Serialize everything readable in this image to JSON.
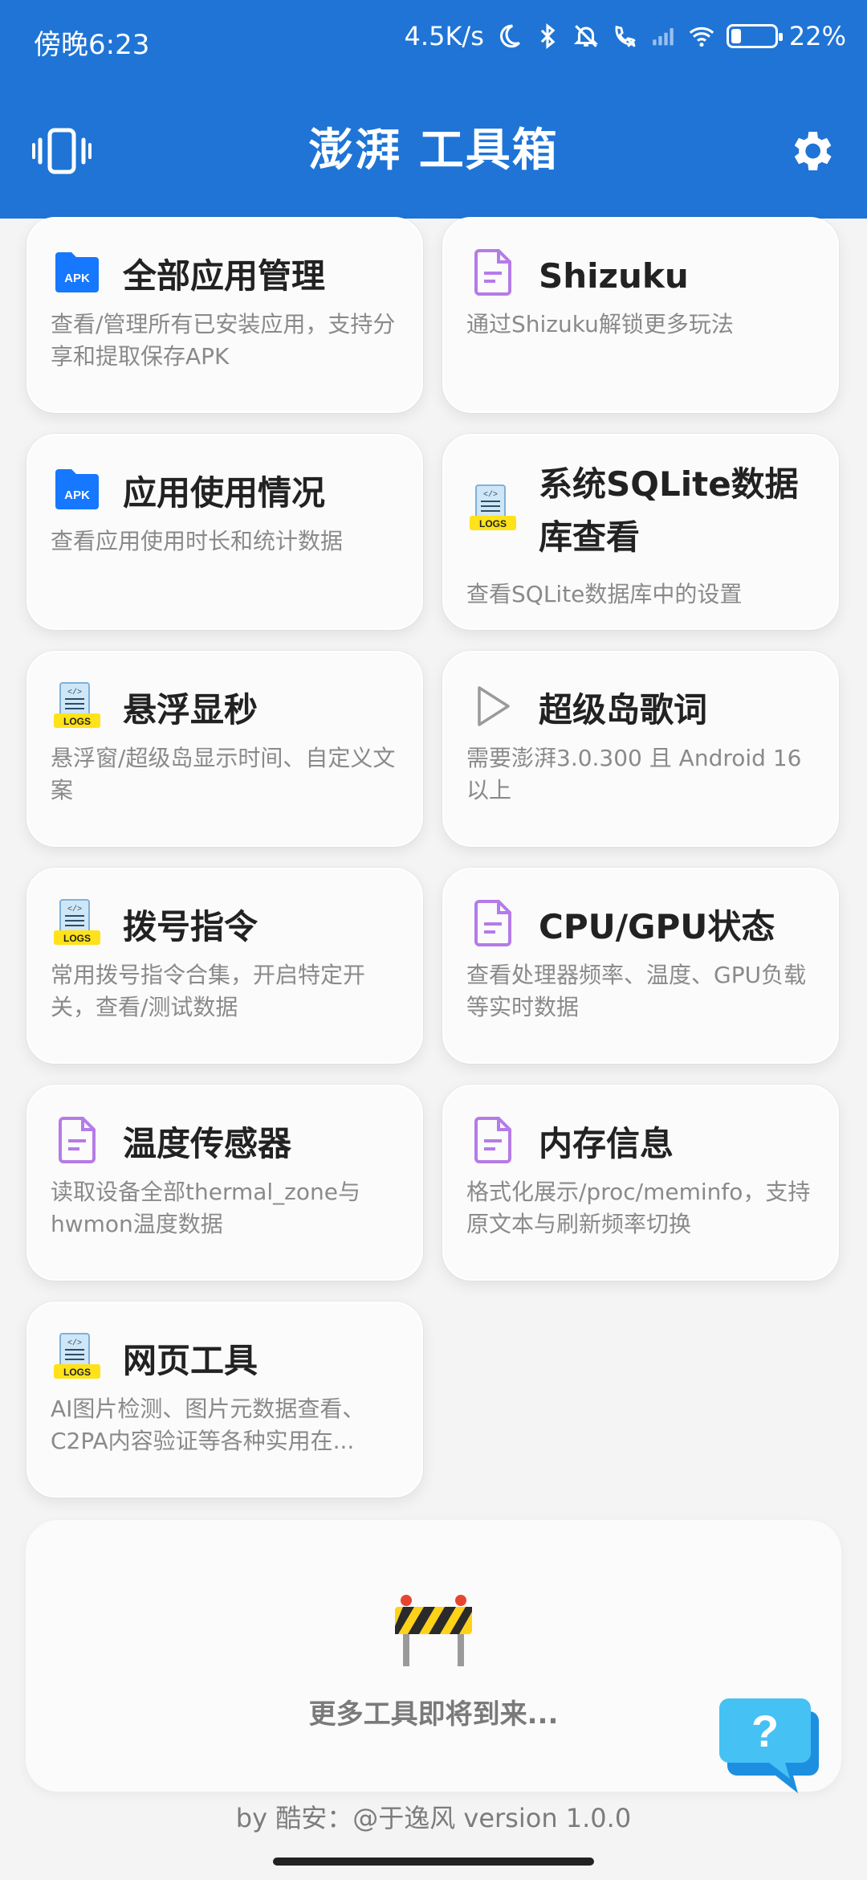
{
  "status_bar": {
    "time": "傍晚6:23",
    "net_speed": "4.5K/s",
    "battery": "22%",
    "battery_level": 0.22
  },
  "app_bar": {
    "title": "澎湃 工具箱",
    "left_icon": "vibrate-icon",
    "right_icon": "gear-icon"
  },
  "tools": [
    {
      "title": "全部应用管理",
      "desc": "查看/管理所有已安装应用，支持分享和提取保存APK",
      "icon": "apk-folder-icon"
    },
    {
      "title": "Shizuku",
      "desc": "通过Shizuku解锁更多玩法",
      "icon": "document-icon"
    },
    {
      "title": "应用使用情况",
      "desc": "查看应用使用时长和统计数据",
      "icon": "apk-folder-icon"
    },
    {
      "title": "系统SQLite数据库查看",
      "desc": "查看SQLite数据库中的设置",
      "icon": "logs-icon"
    },
    {
      "title": "悬浮显秒",
      "desc": "悬浮窗/超级岛显示时间、自定义文案",
      "icon": "logs-icon"
    },
    {
      "title": "超级岛歌词",
      "desc": "需要澎湃3.0.300 且 Android 16 以上",
      "icon": "play-icon"
    },
    {
      "title": "拨号指令",
      "desc": "常用拨号指令合集，开启特定开关，查看/测试数据",
      "icon": "logs-icon"
    },
    {
      "title": "CPU/GPU状态",
      "desc": "查看处理器频率、温度、GPU负载等实时数据",
      "icon": "document-icon"
    },
    {
      "title": "温度传感器",
      "desc": "读取设备全部thermal_zone与hwmon温度数据",
      "icon": "document-icon"
    },
    {
      "title": "内存信息",
      "desc": "格式化展示/proc/meminfo，支持原文本与刷新频率切换",
      "icon": "document-icon"
    },
    {
      "title": "网页工具",
      "desc": "AI图片检测、图片元数据查看、C2PA内容验证等各种实用在...",
      "icon": "logs-icon"
    }
  ],
  "coming_soon": {
    "label": "更多工具即将到来...",
    "icon": "barrier-icon"
  },
  "fab_icon": "help-chat-icon",
  "footer": "by 酷安：@于逸风 version 1.0.0",
  "colors": {
    "primary": "#1f74d6",
    "apk_blue": "#1677ff",
    "doc_purple": "#b57be8",
    "logs_yellow": "#ffe21a",
    "fab_blue": "#3fb8f0"
  }
}
